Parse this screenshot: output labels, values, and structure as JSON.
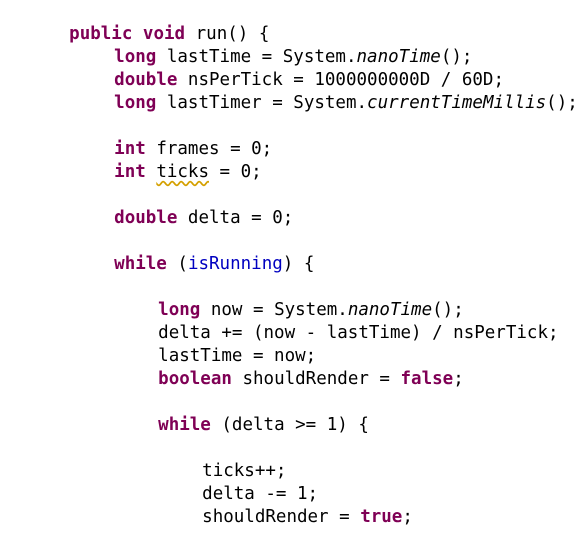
{
  "code": {
    "line1": {
      "kw1": "public",
      "kw2": "void",
      "rest": "run() {"
    },
    "line2": {
      "kw": "long",
      "a": "lastTime = System.",
      "it": "nanoTime",
      "b": "();"
    },
    "line3": {
      "kw": "double",
      "rest": "nsPerTick = 1000000000D / 60D;"
    },
    "line4": {
      "kw": "long",
      "a": "lastTimer = System.",
      "it": "currentTimeMillis",
      "b": "();"
    },
    "line5": {
      "kw": "int",
      "rest": "frames = 0;"
    },
    "line6": {
      "kw": "int",
      "squiggle": "ticks",
      "rest": " = 0;"
    },
    "line7": {
      "kw": "double",
      "rest": "delta = 0;"
    },
    "line8": {
      "kw": "while",
      "a": "(",
      "field": "isRunning",
      "b": ") {"
    },
    "line9": {
      "kw": "long",
      "a": "now = System.",
      "it": "nanoTime",
      "b": "();"
    },
    "line10": {
      "text": "delta += (now - lastTime) / nsPerTick;"
    },
    "line11": {
      "text": "lastTime = now;"
    },
    "line12": {
      "kw": "boolean",
      "a": "shouldRender = ",
      "kw2": "false",
      "b": ";"
    },
    "line13": {
      "kw": "while",
      "rest": "(delta >= 1) {"
    },
    "line14": {
      "text": "ticks++;"
    },
    "line15": {
      "text": "delta -= 1;"
    },
    "line16": {
      "a": "shouldRender = ",
      "kw": "true",
      "b": ";"
    }
  },
  "colors": {
    "keyword": "#7f0055",
    "field": "#0000c0",
    "text": "#000000",
    "warning": "#d4a000"
  }
}
